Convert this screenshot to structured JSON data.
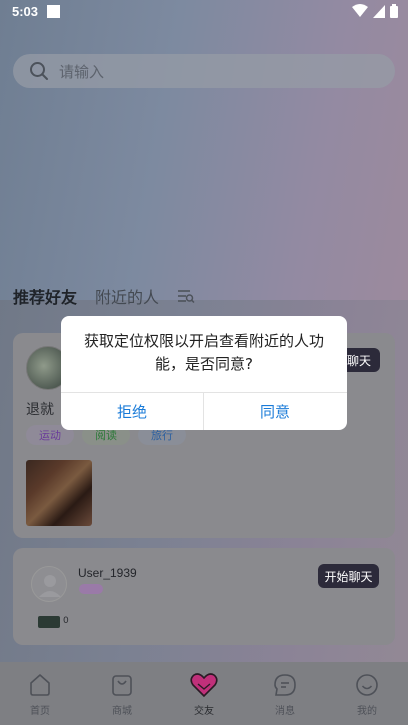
{
  "status_bar": {
    "time": "5:03"
  },
  "search": {
    "placeholder": "请输入"
  },
  "tabs": [
    {
      "label": "推荐好友",
      "active": true
    },
    {
      "label": "附近的人",
      "active": false
    }
  ],
  "cards": [
    {
      "chat_label": "聊天",
      "bio": "退就",
      "tags": [
        "运动",
        "阅读",
        "旅行"
      ]
    },
    {
      "username": "User_1939",
      "chat_label": "开始聊天",
      "badge_count": "0"
    }
  ],
  "nav": [
    {
      "label": "首页",
      "icon": "home-icon"
    },
    {
      "label": "商城",
      "icon": "bag-icon"
    },
    {
      "label": "交友",
      "icon": "heart-icon",
      "active": true
    },
    {
      "label": "消息",
      "icon": "message-icon"
    },
    {
      "label": "我的",
      "icon": "smile-icon"
    }
  ],
  "dialog": {
    "message": "获取定位权限以开启查看附近的人功能，是否同意?",
    "reject_label": "拒绝",
    "accept_label": "同意"
  },
  "colors": {
    "accent": "#1a7bd8",
    "nav_active": "#c0307a",
    "chat_button": "#2c2a3a"
  }
}
